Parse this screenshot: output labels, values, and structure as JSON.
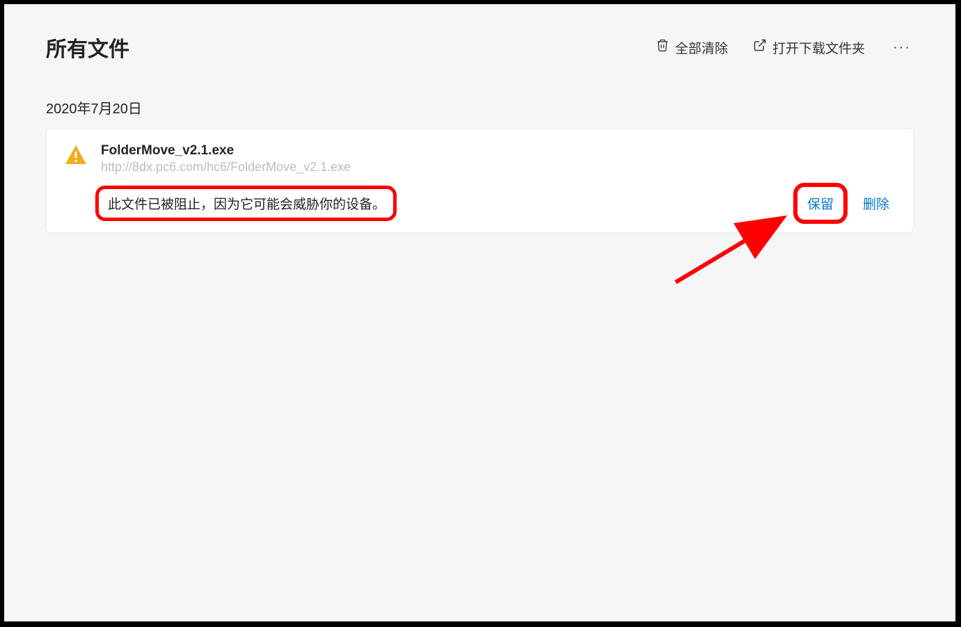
{
  "header": {
    "title": "所有文件",
    "clear_all_label": "全部清除",
    "open_folder_label": "打开下载文件夹"
  },
  "groups": [
    {
      "date": "2020年7月20日",
      "items": [
        {
          "file_name": "FolderMove_v2.1.exe",
          "file_url": "http://8dx.pc6.com/hc6/FolderMove_v2.1.exe",
          "blocked_message": "此文件已被阻止，因为它可能会威胁你的设备。",
          "keep_label": "保留",
          "delete_label": "删除"
        }
      ]
    }
  ]
}
